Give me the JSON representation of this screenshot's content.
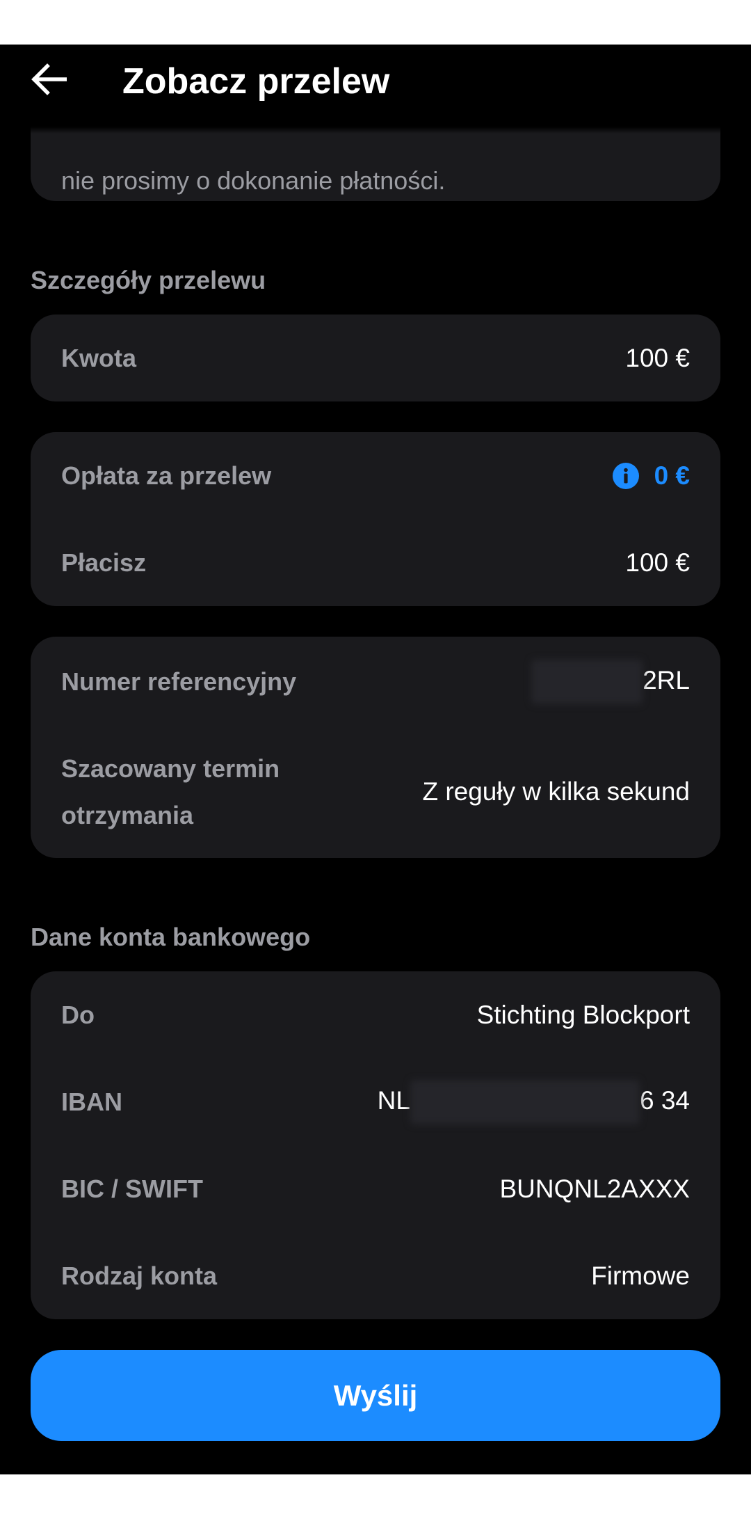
{
  "header": {
    "title": "Zobacz przelew",
    "back_icon": "arrow-left-icon"
  },
  "notice": {
    "partial_text": "nie prosimy o dokonanie płatności."
  },
  "transfer_details": {
    "section_title": "Szczegóły przelewu",
    "amount_label": "Kwota",
    "amount_value": "100 €",
    "fee_label": "Opłata za przelew",
    "fee_value": "0 €",
    "fee_info_icon": "info-icon",
    "you_pay_label": "Płacisz",
    "you_pay_value": "100 €",
    "reference_label": "Numer referencyjny",
    "reference_value_visible": "2RL",
    "eta_label": "Szacowany termin otrzymania",
    "eta_value": "Z reguły w kilka sekund"
  },
  "bank_details": {
    "section_title": "Dane konta bankowego",
    "to_label": "Do",
    "to_value": "Stichting Blockport",
    "iban_label": "IBAN",
    "iban_prefix": "NL",
    "iban_suffix": "6 34",
    "bic_label": "BIC / SWIFT",
    "bic_value": "BUNQNL2AXXX",
    "account_type_label": "Rodzaj konta",
    "account_type_value": "Firmowe"
  },
  "actions": {
    "send_label": "Wyślij"
  },
  "colors": {
    "background": "#000000",
    "card": "#1a1a1d",
    "accent": "#1c8cff",
    "label": "#9c9da3",
    "text": "#ffffff"
  }
}
